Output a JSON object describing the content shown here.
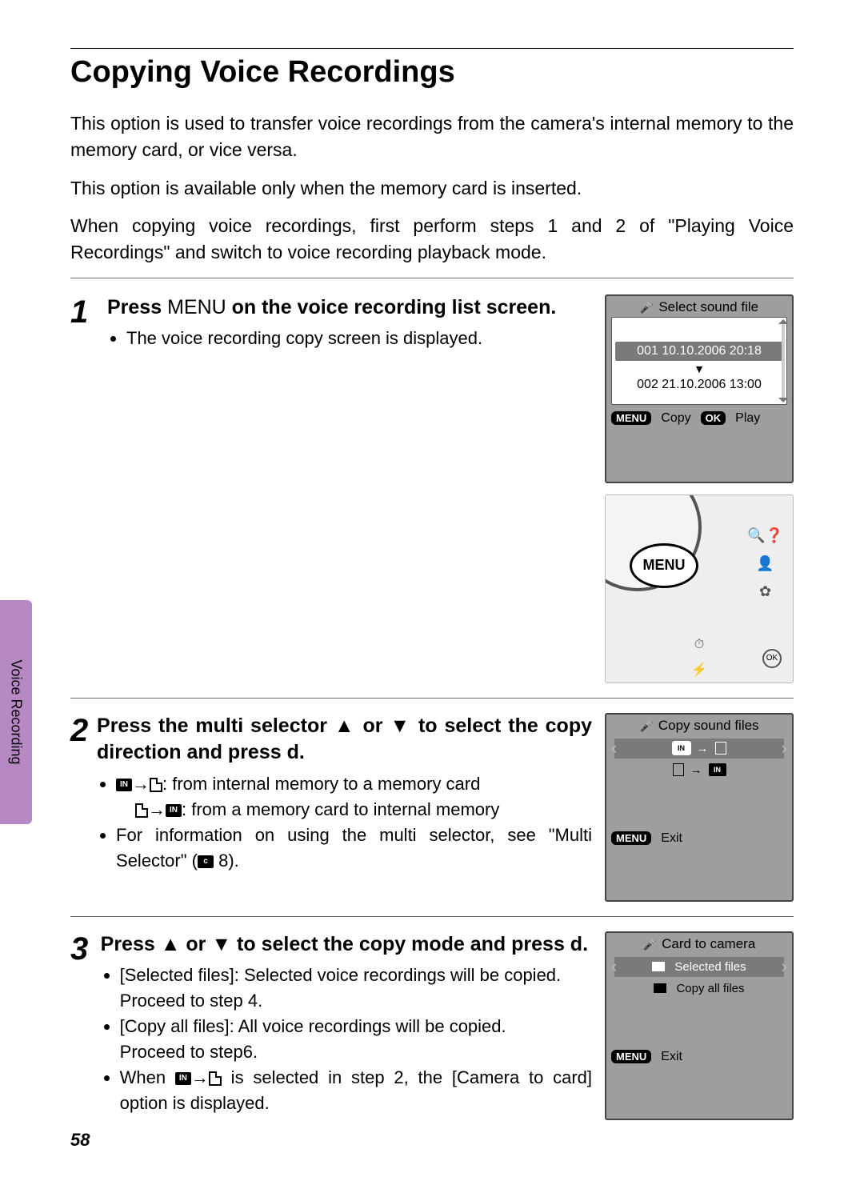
{
  "title": "Copying Voice Recordings",
  "intro1": "This option is used to transfer voice recordings from the camera's internal memory to the memory card, or vice versa.",
  "intro2": "This option is available only when the memory card is inserted.",
  "intro3": "When copying voice recordings, first perform steps 1 and 2 of \"Playing Voice Recordings\" and switch to voice recording playback mode.",
  "sidetab": "Voice Recording",
  "pagenum": "58",
  "steps": {
    "s1": {
      "num": "1",
      "title_a": "Press ",
      "title_menu": "MENU",
      "title_b": " on the voice recording list screen.",
      "b1": "The voice recording copy screen is displayed."
    },
    "s2": {
      "num": "2",
      "title": "Press the multi selector ▲ or ▼ to select the copy direction and press d.",
      "b1_suffix": ": from internal memory to a memory card",
      "b2_suffix": ": from a memory card to internal memory",
      "b3_a": "For information on using the multi selector, see \"Multi Selector\" (",
      "b3_page": " 8).",
      "ref_icon": "c"
    },
    "s3": {
      "num": "3",
      "title": "Press ▲ or ▼ to select the copy mode and press d.",
      "b1": "[Selected files]: Selected voice recordings will be copied.",
      "b1b": "Proceed to step 4.",
      "b2": "[Copy all files]: All voice recordings will be copied.",
      "b2b": "Proceed to step6.",
      "b3_a": "When ",
      "b3_b": " is selected in step 2, the [Camera to card] option is displayed."
    }
  },
  "screens": {
    "s1": {
      "title": "Select sound file",
      "row1": "001 10.10.2006 20:18",
      "row2": "002 21.10.2006 13:00",
      "menu": "MENU",
      "menulbl": "Copy",
      "ok": "OK",
      "oklbl": "Play"
    },
    "camera": {
      "menu": "MENU"
    },
    "s2": {
      "title": "Copy sound files",
      "in": "IN",
      "menu": "MENU",
      "exit": "Exit"
    },
    "s3": {
      "title": "Card to camera",
      "opt1": "Selected files",
      "opt2": "Copy all files",
      "menu": "MENU",
      "exit": "Exit"
    }
  }
}
